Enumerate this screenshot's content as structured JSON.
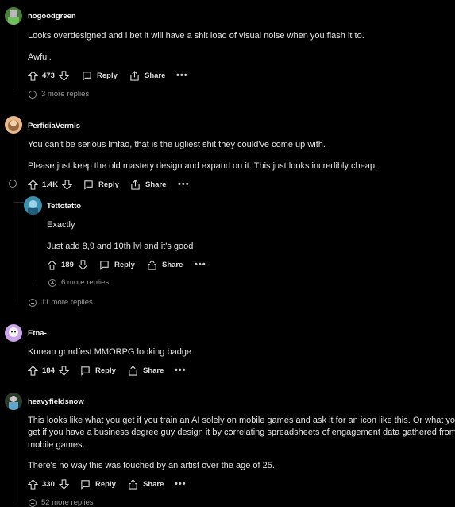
{
  "comments": [
    {
      "username": "nogoodgreen",
      "avatar_icon": "snoo-avatar-icon",
      "paragraphs": [
        "Looks overdesigned and i bet it will have a shit load of visual noise when you flash it to.",
        "Awful."
      ],
      "votes": "473",
      "reply_label": "Reply",
      "share_label": "Share",
      "more_replies": "3 more replies"
    },
    {
      "username": "PerfidiaVermis",
      "avatar_icon": "snoo-avatar-icon",
      "paragraphs": [
        "You can't be serious lmfao, that is the ugliest shit they could've come up with.",
        "Please just keep the old mastery design and expand on it. This just looks incredibly cheap."
      ],
      "votes": "1.4K",
      "reply_label": "Reply",
      "share_label": "Share",
      "more_replies": "11 more replies",
      "child": {
        "username": "Tettotatto",
        "avatar_icon": "snoo-avatar-icon",
        "paragraphs": [
          "Exactly",
          "Just add 8,9 and 10th lvl and it's good"
        ],
        "votes": "189",
        "reply_label": "Reply",
        "share_label": "Share",
        "more_replies": "6 more replies"
      }
    },
    {
      "username": "Etna-",
      "avatar_icon": "snoo-avatar-icon",
      "paragraphs": [
        "Korean grindfest MMORPG looking badge"
      ],
      "votes": "184",
      "reply_label": "Reply",
      "share_label": "Share"
    },
    {
      "username": "heavyfieldsnow",
      "avatar_icon": "snoo-avatar-icon",
      "paragraphs": [
        "This looks like what you get if you train an AI solely on mobile games and ask it for an icon like this. Or what you",
        "get if you have a business degree guy design it by correlating spreadsheets of engagement data gathered from",
        "mobile games.",
        "There's no way this was touched by an artist over the age of 25."
      ],
      "votes": "330",
      "reply_label": "Reply",
      "share_label": "Share",
      "more_replies": "52 more replies"
    }
  ],
  "overflow_label": "•••",
  "colors": {
    "background": "#000000",
    "text": "#e4e4e4",
    "thread_line": "#2b2b2b"
  }
}
